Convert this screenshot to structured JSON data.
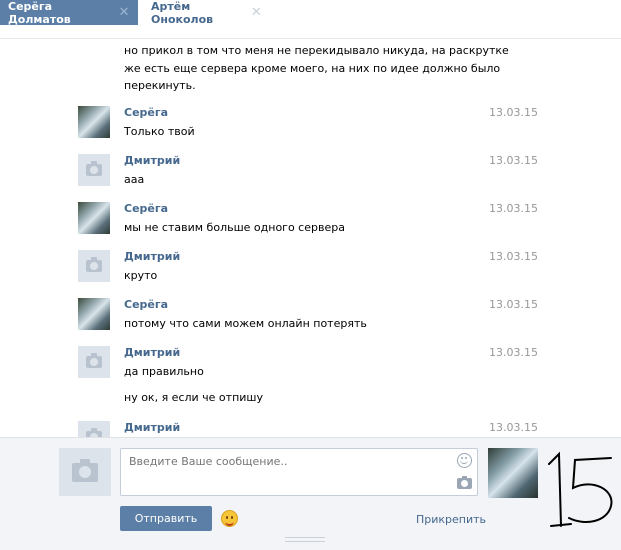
{
  "tabs": [
    {
      "label": "Серёга Долматов",
      "active": true
    },
    {
      "label": "Артём Оноколов",
      "active": false
    }
  ],
  "continuation": [
    "но прикол в том что меня не перекидывало никуда, на раскрутке",
    "же есть еще сервера кроме моего, на них по идее должно было",
    "перекинуть."
  ],
  "messages": [
    {
      "author": "Серёга",
      "text": "Только твой",
      "date": "13.03.15",
      "avatar": "photo"
    },
    {
      "author": "Дмитрий",
      "text": "ааа",
      "date": "13.03.15",
      "avatar": "empty"
    },
    {
      "author": "Серёга",
      "text": "мы не ставим больше одного сервера",
      "date": "13.03.15",
      "avatar": "photo"
    },
    {
      "author": "Дмитрий",
      "text": "круто",
      "date": "13.03.15",
      "avatar": "empty"
    },
    {
      "author": "Серёга",
      "text": "потому что сами можем онлайн потерять",
      "date": "13.03.15",
      "avatar": "photo"
    },
    {
      "author": "Дмитрий",
      "text": "да правильно",
      "date": "13.03.15",
      "avatar": "empty"
    }
  ],
  "extra_line": "ну ок, я если че отпишу",
  "partial_message": {
    "author": "Дмитрий",
    "date": "13.03.15"
  },
  "composer": {
    "placeholder": "Введите Ваше сообщение..",
    "send_label": "Отправить",
    "attach_label": "Прикрепить"
  },
  "annotation": "15",
  "colors": {
    "accent": "#5b7fa6",
    "link": "#45688e",
    "date": "#999999"
  }
}
